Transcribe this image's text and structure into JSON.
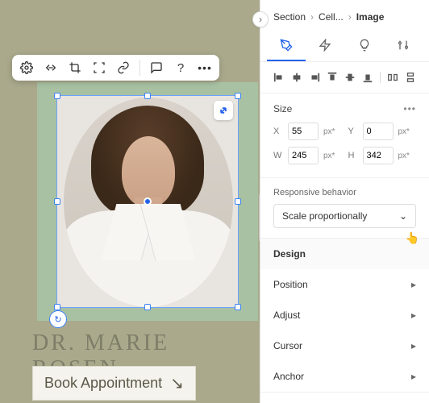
{
  "breadcrumb": {
    "section": "Section",
    "cell": "Cell...",
    "image": "Image"
  },
  "floating_toolbar": {
    "icons": [
      "settings",
      "link-unlink",
      "crop",
      "focus",
      "attach",
      "divider",
      "comment",
      "help",
      "more"
    ]
  },
  "canvas": {
    "title": "DR. MARIE ROSEN",
    "book_label": "Book Appointment",
    "book_arrow": "↘"
  },
  "tabs": {
    "active": "design"
  },
  "size_section": {
    "label": "Size",
    "x_label": "X",
    "x_value": "55",
    "x_unit": "px*",
    "y_label": "Y",
    "y_value": "0",
    "y_unit": "px*",
    "w_label": "W",
    "w_value": "245",
    "w_unit": "px*",
    "h_label": "H",
    "h_value": "342",
    "h_unit": "px*"
  },
  "responsive": {
    "label": "Responsive behavior",
    "value": "Scale proportionally"
  },
  "accordion": {
    "design": "Design",
    "position": "Position",
    "adjust": "Adjust",
    "cursor": "Cursor",
    "anchor": "Anchor"
  }
}
